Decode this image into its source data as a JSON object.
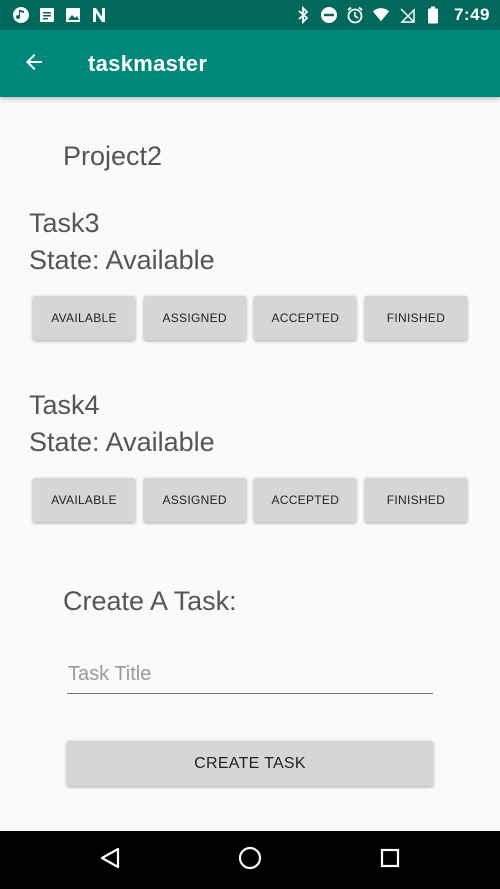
{
  "status_bar": {
    "time": "7:49",
    "left_icons": [
      "music-note-icon",
      "message-icon",
      "image-icon",
      "n-logo-icon"
    ],
    "right_icons": [
      "bluetooth-icon",
      "do-not-disturb-icon",
      "alarm-icon",
      "wifi-icon",
      "no-sim-icon",
      "battery-icon"
    ]
  },
  "app_bar": {
    "title": "taskmaster",
    "back_icon": "arrow-back-icon"
  },
  "project": {
    "name": "Project2"
  },
  "tasks": [
    {
      "title": "Task3",
      "state": "State: Available",
      "buttons": [
        "AVAILABLE",
        "ASSIGNED",
        "ACCEPTED",
        "FINISHED"
      ]
    },
    {
      "title": "Task4",
      "state": "State: Available",
      "buttons": [
        "AVAILABLE",
        "ASSIGNED",
        "ACCEPTED",
        "FINISHED"
      ]
    }
  ],
  "create": {
    "heading": "Create A Task:",
    "input_value": "",
    "input_placeholder": "Task Title",
    "button_label": "CREATE TASK"
  },
  "nav_bar": {
    "icons": [
      "back-triangle-icon",
      "home-circle-icon",
      "recents-square-icon"
    ]
  },
  "colors": {
    "status_bar": "#00695c",
    "app_bar": "#00897b",
    "background": "#fafafa",
    "button": "#d6d6d6"
  }
}
